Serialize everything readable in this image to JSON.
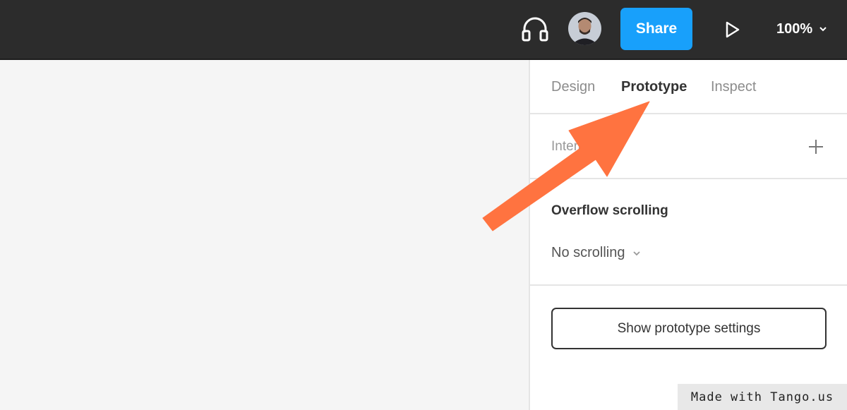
{
  "toolbar": {
    "share_label": "Share",
    "zoom_label": "100%",
    "icons": [
      "headphones-icon",
      "avatar",
      "play-icon",
      "chevron-down-icon"
    ],
    "share_color": "#18a0fb"
  },
  "panel": {
    "tabs": [
      {
        "label": "Design",
        "active": false
      },
      {
        "label": "Prototype",
        "active": true
      },
      {
        "label": "Inspect",
        "active": false
      }
    ],
    "interactions_label": "Interactions",
    "overflow_title": "Overflow scrolling",
    "overflow_value": "No scrolling",
    "settings_button_label": "Show prototype settings"
  },
  "annotation": {
    "arrow_color": "#ff7340"
  },
  "watermark": {
    "text": "Made with Tango.us"
  }
}
